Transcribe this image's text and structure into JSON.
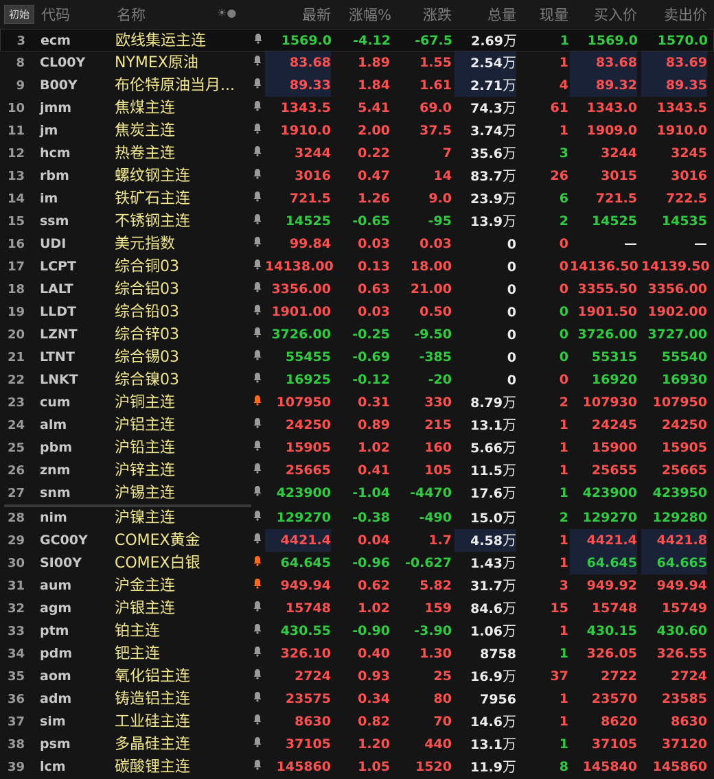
{
  "header": {
    "start_btn": "初始",
    "code": "代码",
    "name": "名称",
    "icons": "☀●",
    "last": "最新",
    "pct": "涨幅%",
    "chg": "涨跌",
    "vol": "总量",
    "now": "现量",
    "bid": "买入价",
    "ask": "卖出价"
  },
  "unit_wan": "万",
  "rows": [
    {
      "i": "3",
      "code": "ecm",
      "name": "欧线集运主连",
      "bell": "gray",
      "last": "1569.0",
      "pct": "-4.12",
      "chg": "-67.5",
      "vol": "2.69",
      "vu": "万",
      "now": "1",
      "bid": "1569.0",
      "ask": "1570.0",
      "color": "green"
    },
    {
      "i": "8",
      "code": "CL00Y",
      "name": "NYMEX原油",
      "bell": "gray",
      "last": "83.68",
      "pct": "1.89",
      "chg": "1.55",
      "vol": "2.54",
      "vu": "万",
      "now": "1",
      "bid": "83.68",
      "ask": "83.69",
      "color": "red"
    },
    {
      "i": "9",
      "code": "B00Y",
      "name": "布伦特原油当月...",
      "bell": "gray",
      "last": "89.33",
      "pct": "1.84",
      "chg": "1.61",
      "vol": "2.71",
      "vu": "万",
      "now": "4",
      "bid": "89.32",
      "ask": "89.35",
      "color": "red"
    },
    {
      "i": "10",
      "code": "jmm",
      "name": "焦煤主连",
      "bell": "gray",
      "last": "1343.5",
      "pct": "5.41",
      "chg": "69.0",
      "vol": "74.3",
      "vu": "万",
      "now": "61",
      "bid": "1343.0",
      "ask": "1343.5",
      "color": "red"
    },
    {
      "i": "11",
      "code": "jm",
      "name": "焦炭主连",
      "bell": "gray",
      "last": "1910.0",
      "pct": "2.00",
      "chg": "37.5",
      "vol": "3.74",
      "vu": "万",
      "now": "1",
      "bid": "1909.0",
      "ask": "1910.0",
      "color": "red"
    },
    {
      "i": "12",
      "code": "hcm",
      "name": "热卷主连",
      "bell": "gray",
      "last": "3244",
      "pct": "0.22",
      "chg": "7",
      "vol": "35.6",
      "vu": "万",
      "now": "3",
      "bid": "3244",
      "ask": "3245",
      "color": "red",
      "nowcolor": "green"
    },
    {
      "i": "13",
      "code": "rbm",
      "name": "螺纹钢主连",
      "bell": "gray",
      "last": "3016",
      "pct": "0.47",
      "chg": "14",
      "vol": "83.7",
      "vu": "万",
      "now": "26",
      "bid": "3015",
      "ask": "3016",
      "color": "red"
    },
    {
      "i": "14",
      "code": "im",
      "name": "铁矿石主连",
      "bell": "gray",
      "last": "721.5",
      "pct": "1.26",
      "chg": "9.0",
      "vol": "23.9",
      "vu": "万",
      "now": "6",
      "bid": "721.5",
      "ask": "722.5",
      "color": "red",
      "nowcolor": "green"
    },
    {
      "i": "15",
      "code": "ssm",
      "name": "不锈钢主连",
      "bell": "gray",
      "last": "14525",
      "pct": "-0.65",
      "chg": "-95",
      "vol": "13.9",
      "vu": "万",
      "now": "2",
      "bid": "14525",
      "ask": "14535",
      "color": "green"
    },
    {
      "i": "16",
      "code": "UDI",
      "name": "美元指数",
      "bell": "gray",
      "last": "99.84",
      "pct": "0.03",
      "chg": "0.03",
      "vol": "0",
      "vu": "",
      "now": "0",
      "bid": "—",
      "ask": "—",
      "color": "red",
      "bidcolor": "white"
    },
    {
      "i": "17",
      "code": "LCPT",
      "name": "综合铜03",
      "bell": "gray",
      "last": "14138.00",
      "pct": "0.13",
      "chg": "18.00",
      "vol": "0",
      "vu": "",
      "now": "0",
      "bid": "14136.50",
      "ask": "14139.50",
      "color": "red"
    },
    {
      "i": "18",
      "code": "LALT",
      "name": "综合铝03",
      "bell": "gray",
      "last": "3356.00",
      "pct": "0.63",
      "chg": "21.00",
      "vol": "0",
      "vu": "",
      "now": "0",
      "bid": "3355.50",
      "ask": "3356.00",
      "color": "red"
    },
    {
      "i": "19",
      "code": "LLDT",
      "name": "综合铅03",
      "bell": "gray",
      "last": "1901.00",
      "pct": "0.03",
      "chg": "0.50",
      "vol": "0",
      "vu": "",
      "now": "0",
      "bid": "1901.50",
      "ask": "1902.00",
      "color": "red",
      "nowcolor": "green"
    },
    {
      "i": "20",
      "code": "LZNT",
      "name": "综合锌03",
      "bell": "gray",
      "last": "3726.00",
      "pct": "-0.25",
      "chg": "-9.50",
      "vol": "0",
      "vu": "",
      "now": "0",
      "bid": "3726.00",
      "ask": "3727.00",
      "color": "green"
    },
    {
      "i": "21",
      "code": "LTNT",
      "name": "综合锡03",
      "bell": "gray",
      "last": "55455",
      "pct": "-0.69",
      "chg": "-385",
      "vol": "0",
      "vu": "",
      "now": "0",
      "bid": "55315",
      "ask": "55540",
      "color": "green"
    },
    {
      "i": "22",
      "code": "LNKT",
      "name": "综合镍03",
      "bell": "gray",
      "last": "16925",
      "pct": "-0.12",
      "chg": "-20",
      "vol": "0",
      "vu": "",
      "now": "0",
      "bid": "16920",
      "ask": "16930",
      "color": "green",
      "nowcolor": "red"
    },
    {
      "i": "23",
      "code": "cum",
      "name": "沪铜主连",
      "bell": "orange",
      "last": "107950",
      "pct": "0.31",
      "chg": "330",
      "vol": "8.79",
      "vu": "万",
      "now": "2",
      "bid": "107930",
      "ask": "107950",
      "color": "red"
    },
    {
      "i": "24",
      "code": "alm",
      "name": "沪铝主连",
      "bell": "gray",
      "last": "24250",
      "pct": "0.89",
      "chg": "215",
      "vol": "13.1",
      "vu": "万",
      "now": "1",
      "bid": "24245",
      "ask": "24250",
      "color": "red"
    },
    {
      "i": "25",
      "code": "pbm",
      "name": "沪铅主连",
      "bell": "gray",
      "last": "15905",
      "pct": "1.02",
      "chg": "160",
      "vol": "5.66",
      "vu": "万",
      "now": "1",
      "bid": "15900",
      "ask": "15905",
      "color": "red"
    },
    {
      "i": "26",
      "code": "znm",
      "name": "沪锌主连",
      "bell": "gray",
      "last": "25665",
      "pct": "0.41",
      "chg": "105",
      "vol": "11.5",
      "vu": "万",
      "now": "1",
      "bid": "25655",
      "ask": "25665",
      "color": "red"
    },
    {
      "i": "27",
      "code": "snm",
      "name": "沪锡主连",
      "bell": "gray",
      "last": "423900",
      "pct": "-1.04",
      "chg": "-4470",
      "vol": "17.6",
      "vu": "万",
      "now": "1",
      "bid": "423900",
      "ask": "423950",
      "color": "green"
    },
    {
      "i": "28",
      "code": "nim",
      "name": "沪镍主连",
      "bell": "gray",
      "last": "129270",
      "pct": "-0.38",
      "chg": "-490",
      "vol": "15.0",
      "vu": "万",
      "now": "2",
      "bid": "129270",
      "ask": "129280",
      "color": "green"
    },
    {
      "i": "29",
      "code": "GC00Y",
      "name": "COMEX黄金",
      "bell": "gray",
      "last": "4421.4",
      "pct": "0.04",
      "chg": "1.7",
      "vol": "4.58",
      "vu": "万",
      "now": "1",
      "bid": "4421.4",
      "ask": "4421.8",
      "color": "red"
    },
    {
      "i": "30",
      "code": "SI00Y",
      "name": "COMEX白银",
      "bell": "orange",
      "last": "64.645",
      "pct": "-0.96",
      "chg": "-0.627",
      "vol": "1.43",
      "vu": "万",
      "now": "1",
      "bid": "64.645",
      "ask": "64.665",
      "color": "green",
      "nowcolor": "red"
    },
    {
      "i": "31",
      "code": "aum",
      "name": "沪金主连",
      "bell": "orange",
      "last": "949.94",
      "pct": "0.62",
      "chg": "5.82",
      "vol": "31.7",
      "vu": "万",
      "now": "3",
      "bid": "949.92",
      "ask": "949.94",
      "color": "red"
    },
    {
      "i": "32",
      "code": "agm",
      "name": "沪银主连",
      "bell": "gray",
      "last": "15748",
      "pct": "1.02",
      "chg": "159",
      "vol": "84.6",
      "vu": "万",
      "now": "15",
      "bid": "15748",
      "ask": "15749",
      "color": "red"
    },
    {
      "i": "33",
      "code": "ptm",
      "name": "铂主连",
      "bell": "gray",
      "last": "430.55",
      "pct": "-0.90",
      "chg": "-3.90",
      "vol": "1.06",
      "vu": "万",
      "now": "1",
      "bid": "430.15",
      "ask": "430.60",
      "color": "green",
      "nowcolor": "red"
    },
    {
      "i": "34",
      "code": "pdm",
      "name": "钯主连",
      "bell": "gray",
      "last": "326.10",
      "pct": "0.40",
      "chg": "1.30",
      "vol": "8758",
      "vu": "",
      "now": "1",
      "bid": "326.05",
      "ask": "326.55",
      "color": "red",
      "nowcolor": "green"
    },
    {
      "i": "35",
      "code": "aom",
      "name": "氧化铝主连",
      "bell": "gray",
      "last": "2724",
      "pct": "0.93",
      "chg": "25",
      "vol": "16.9",
      "vu": "万",
      "now": "37",
      "bid": "2722",
      "ask": "2724",
      "color": "red"
    },
    {
      "i": "36",
      "code": "adm",
      "name": "铸造铝主连",
      "bell": "gray",
      "last": "23575",
      "pct": "0.34",
      "chg": "80",
      "vol": "7956",
      "vu": "",
      "now": "1",
      "bid": "23570",
      "ask": "23585",
      "color": "red"
    },
    {
      "i": "37",
      "code": "sim",
      "name": "工业硅主连",
      "bell": "gray",
      "last": "8630",
      "pct": "0.82",
      "chg": "70",
      "vol": "14.6",
      "vu": "万",
      "now": "1",
      "bid": "8620",
      "ask": "8630",
      "color": "red"
    },
    {
      "i": "38",
      "code": "psm",
      "name": "多晶硅主连",
      "bell": "gray",
      "last": "37105",
      "pct": "1.20",
      "chg": "440",
      "vol": "13.1",
      "vu": "万",
      "now": "1",
      "bid": "37105",
      "ask": "37120",
      "color": "red",
      "nowcolor": "green"
    },
    {
      "i": "39",
      "code": "lcm",
      "name": "碳酸锂主连",
      "bell": "gray",
      "last": "145860",
      "pct": "1.05",
      "chg": "1520",
      "vol": "11.9",
      "vu": "万",
      "now": "8",
      "bid": "145840",
      "ask": "145860",
      "color": "red",
      "nowcolor": "green"
    }
  ]
}
